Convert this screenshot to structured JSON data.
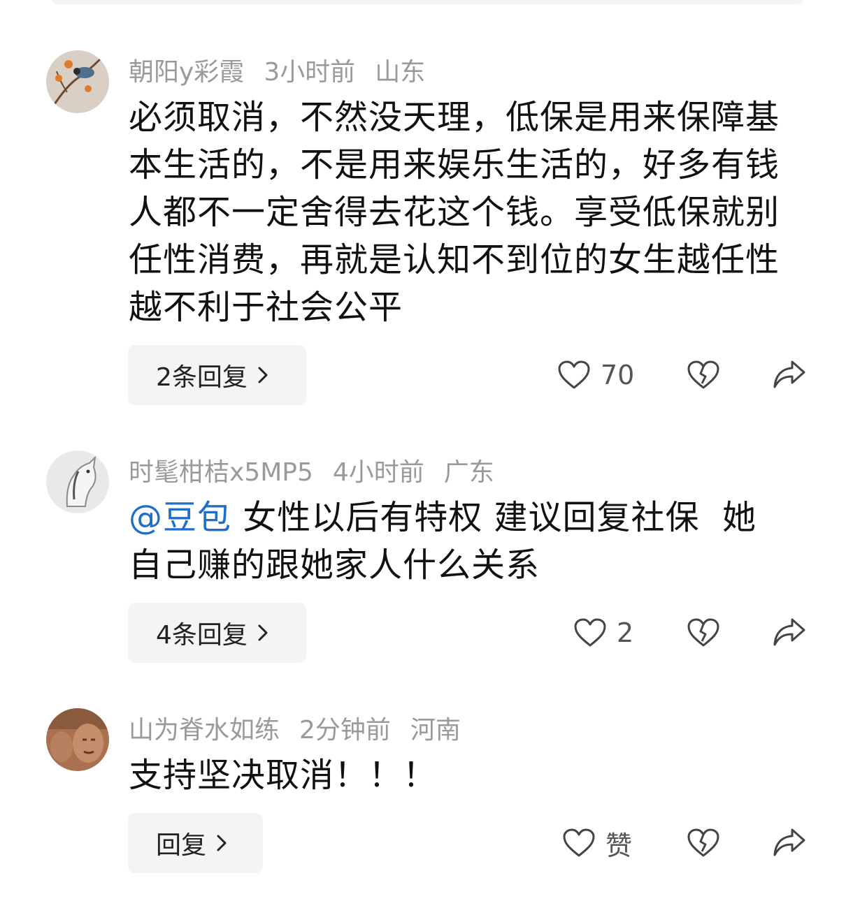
{
  "comments": [
    {
      "username": "朝阳y彩霞",
      "time": "3小时前",
      "location": "山东",
      "text": "必须取消，不然没天理，低保是用来保障基本生活的，不是用来娱乐生活的，好多有钱人都不一定舍得去花这个钱。享受低保就别任性消费，再就是认知不到位的女生越任性越不利于社会公平",
      "reply_label": "2条回复",
      "like_count": "70"
    },
    {
      "username": "时髦柑桔x5MP5",
      "time": "4小时前",
      "location": "广东",
      "mention": "@豆包",
      "text": " 女性以后有特权 建议回复社保  她自己赚的跟她家人什么关系",
      "reply_label": "4条回复",
      "like_count": "2"
    },
    {
      "username": "山为脊水如练",
      "time": "2分钟前",
      "location": "河南",
      "text": "支持坚决取消！！！",
      "reply_label": "回复",
      "like_count": "赞"
    }
  ],
  "icons": {
    "like": "heart-outline-icon",
    "dislike": "broken-heart-icon",
    "share": "share-arrow-icon",
    "chevron": "chevron-right-icon"
  },
  "colors": {
    "username": "#9a9a9a",
    "mention": "#1f6fc8",
    "button_bg": "#f4f4f4"
  }
}
